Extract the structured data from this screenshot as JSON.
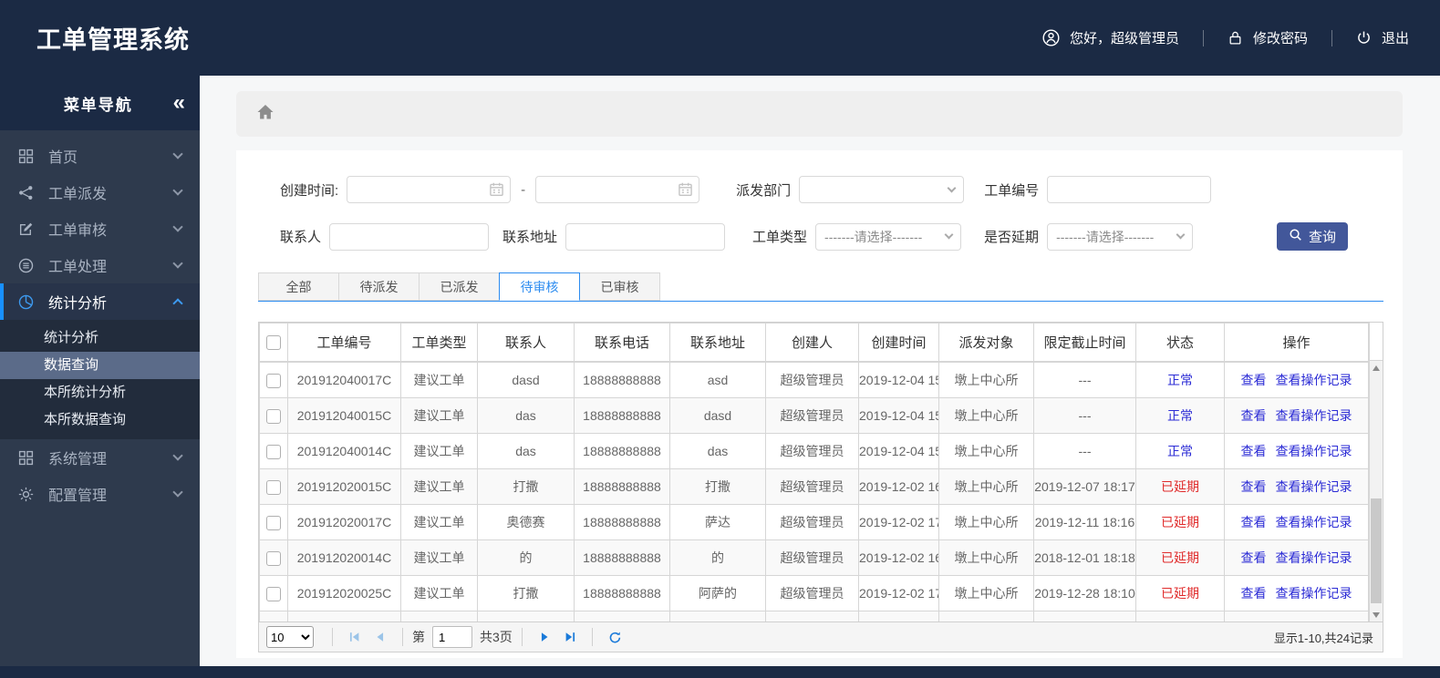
{
  "colors": {
    "header_navy": "#1b2a44",
    "sidebar_bg": "#2e3a4d",
    "submenu_selected": "#5b6b89",
    "active_bar_blue": "#1890ff",
    "tab_accent_blue": "#2d8cf0",
    "link_blue": "#2b2bd5",
    "danger_red": "#e02b2b",
    "search_button_navy": "#42579a"
  },
  "header": {
    "title": "工单管理系统",
    "greeting": "您好，超级管理员",
    "change_password": "修改密码",
    "logout": "退出"
  },
  "sidebar": {
    "nav_title": "菜单导航",
    "collapse_glyph": "«",
    "items": [
      {
        "label": "首页",
        "icon": "grid-icon"
      },
      {
        "label": "工单派发",
        "icon": "share-icon"
      },
      {
        "label": "工单审核",
        "icon": "edit-icon"
      },
      {
        "label": "工单处理",
        "icon": "process-icon"
      },
      {
        "label": "统计分析",
        "icon": "pie-chart-icon"
      },
      {
        "label": "系统管理",
        "icon": "modules-icon"
      },
      {
        "label": "配置管理",
        "icon": "gear-icon"
      }
    ],
    "submenu": [
      {
        "label": "统计分析",
        "selected": ""
      },
      {
        "label": "数据查询",
        "selected": "selected"
      },
      {
        "label": "本所统计分析",
        "selected": ""
      },
      {
        "label": "本所数据查询",
        "selected": ""
      }
    ]
  },
  "filters": {
    "created_label": "创建时间:",
    "range_separator": "-",
    "department_label": "派发部门",
    "order_no_label": "工单编号",
    "contact_label": "联系人",
    "address_label": "联系地址",
    "type_label": "工单类型",
    "type_placeholder": "-------请选择-------",
    "delay_label": "是否延期",
    "delay_placeholder": "-------请选择-------",
    "search_button": "查询"
  },
  "tabs": [
    {
      "label": "全部",
      "state": ""
    },
    {
      "label": "待派发",
      "state": ""
    },
    {
      "label": "已派发",
      "state": ""
    },
    {
      "label": "待审核",
      "state": "active"
    },
    {
      "label": "已审核",
      "state": ""
    }
  ],
  "table": {
    "columns": [
      "工单编号",
      "工单类型",
      "联系人",
      "联系电话",
      "联系地址",
      "创建人",
      "创建时间",
      "派发对象",
      "限定截止时间",
      "状态",
      "操作"
    ],
    "action_view": "查看",
    "action_view_log": "查看操作记录",
    "rows": [
      {
        "id": "201912040017C",
        "type": "建议工单",
        "contact": "dasd",
        "phone": "18888888888",
        "address": "asd",
        "creator": "超级管理员",
        "created": "2019-12-04 15",
        "target": "墩上中心所",
        "deadline": "---",
        "status": "正常",
        "status_class": "status-normal"
      },
      {
        "id": "201912040015C",
        "type": "建议工单",
        "contact": "das",
        "phone": "18888888888",
        "address": "dasd",
        "creator": "超级管理员",
        "created": "2019-12-04 15",
        "target": "墩上中心所",
        "deadline": "---",
        "status": "正常",
        "status_class": "status-normal"
      },
      {
        "id": "201912040014C",
        "type": "建议工单",
        "contact": "das",
        "phone": "18888888888",
        "address": "das",
        "creator": "超级管理员",
        "created": "2019-12-04 15",
        "target": "墩上中心所",
        "deadline": "---",
        "status": "正常",
        "status_class": "status-normal"
      },
      {
        "id": "201912020015C",
        "type": "建议工单",
        "contact": "打撒",
        "phone": "18888888888",
        "address": "打撒",
        "creator": "超级管理员",
        "created": "2019-12-02 16",
        "target": "墩上中心所",
        "deadline": "2019-12-07 18:17",
        "status": "已延期",
        "status_class": "status-delayed"
      },
      {
        "id": "201912020017C",
        "type": "建议工单",
        "contact": "奥德赛",
        "phone": "18888888888",
        "address": "萨达",
        "creator": "超级管理员",
        "created": "2019-12-02 17",
        "target": "墩上中心所",
        "deadline": "2019-12-11 18:16",
        "status": "已延期",
        "status_class": "status-delayed"
      },
      {
        "id": "201912020014C",
        "type": "建议工单",
        "contact": "的",
        "phone": "18888888888",
        "address": "的",
        "creator": "超级管理员",
        "created": "2019-12-02 16",
        "target": "墩上中心所",
        "deadline": "2018-12-01 18:18",
        "status": "已延期",
        "status_class": "status-delayed"
      },
      {
        "id": "201912020025C",
        "type": "建议工单",
        "contact": "打撒",
        "phone": "18888888888",
        "address": "阿萨的",
        "creator": "超级管理员",
        "created": "2019-12-02 17",
        "target": "墩上中心所",
        "deadline": "2019-12-28 18:10",
        "status": "已延期",
        "status_class": "status-delayed"
      },
      {
        "id": "",
        "type": "",
        "contact": "",
        "phone": "",
        "address": "",
        "creator": "",
        "created": "",
        "target": "",
        "deadline": "",
        "status": "",
        "status_class": ""
      }
    ]
  },
  "pagination": {
    "page_size": "10",
    "page_prefix": "第",
    "current_page": "1",
    "total_pages": "共3页",
    "summary": "显示1-10,共24记录"
  }
}
